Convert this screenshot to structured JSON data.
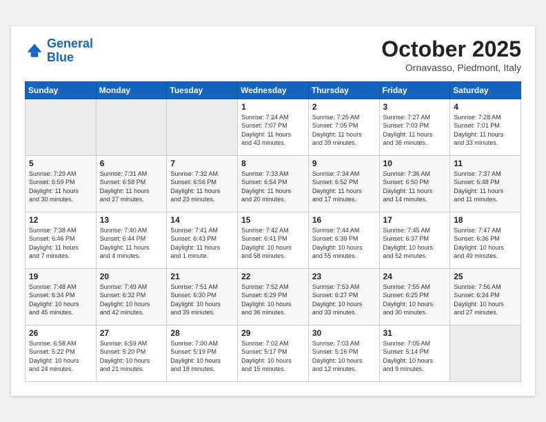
{
  "header": {
    "logo": {
      "line1": "General",
      "line2": "Blue"
    },
    "title": "October 2025",
    "location": "Ornavasso, Piedmont, Italy"
  },
  "weekdays": [
    "Sunday",
    "Monday",
    "Tuesday",
    "Wednesday",
    "Thursday",
    "Friday",
    "Saturday"
  ],
  "weeks": [
    [
      {
        "day": "",
        "info": ""
      },
      {
        "day": "",
        "info": ""
      },
      {
        "day": "",
        "info": ""
      },
      {
        "day": "1",
        "info": "Sunrise: 7:24 AM\nSunset: 7:07 PM\nDaylight: 11 hours\nand 43 minutes."
      },
      {
        "day": "2",
        "info": "Sunrise: 7:25 AM\nSunset: 7:05 PM\nDaylight: 11 hours\nand 39 minutes."
      },
      {
        "day": "3",
        "info": "Sunrise: 7:27 AM\nSunset: 7:03 PM\nDaylight: 11 hours\nand 36 minutes."
      },
      {
        "day": "4",
        "info": "Sunrise: 7:28 AM\nSunset: 7:01 PM\nDaylight: 11 hours\nand 33 minutes."
      }
    ],
    [
      {
        "day": "5",
        "info": "Sunrise: 7:29 AM\nSunset: 6:59 PM\nDaylight: 11 hours\nand 30 minutes."
      },
      {
        "day": "6",
        "info": "Sunrise: 7:31 AM\nSunset: 6:58 PM\nDaylight: 11 hours\nand 27 minutes."
      },
      {
        "day": "7",
        "info": "Sunrise: 7:32 AM\nSunset: 6:56 PM\nDaylight: 11 hours\nand 23 minutes."
      },
      {
        "day": "8",
        "info": "Sunrise: 7:33 AM\nSunset: 6:54 PM\nDaylight: 11 hours\nand 20 minutes."
      },
      {
        "day": "9",
        "info": "Sunrise: 7:34 AM\nSunset: 6:52 PM\nDaylight: 11 hours\nand 17 minutes."
      },
      {
        "day": "10",
        "info": "Sunrise: 7:36 AM\nSunset: 6:50 PM\nDaylight: 11 hours\nand 14 minutes."
      },
      {
        "day": "11",
        "info": "Sunrise: 7:37 AM\nSunset: 6:48 PM\nDaylight: 11 hours\nand 11 minutes."
      }
    ],
    [
      {
        "day": "12",
        "info": "Sunrise: 7:38 AM\nSunset: 6:46 PM\nDaylight: 11 hours\nand 7 minutes."
      },
      {
        "day": "13",
        "info": "Sunrise: 7:40 AM\nSunset: 6:44 PM\nDaylight: 11 hours\nand 4 minutes."
      },
      {
        "day": "14",
        "info": "Sunrise: 7:41 AM\nSunset: 6:43 PM\nDaylight: 11 hours\nand 1 minute."
      },
      {
        "day": "15",
        "info": "Sunrise: 7:42 AM\nSunset: 6:41 PM\nDaylight: 10 hours\nand 58 minutes."
      },
      {
        "day": "16",
        "info": "Sunrise: 7:44 AM\nSunset: 6:39 PM\nDaylight: 10 hours\nand 55 minutes."
      },
      {
        "day": "17",
        "info": "Sunrise: 7:45 AM\nSunset: 6:37 PM\nDaylight: 10 hours\nand 52 minutes."
      },
      {
        "day": "18",
        "info": "Sunrise: 7:47 AM\nSunset: 6:36 PM\nDaylight: 10 hours\nand 49 minutes."
      }
    ],
    [
      {
        "day": "19",
        "info": "Sunrise: 7:48 AM\nSunset: 6:34 PM\nDaylight: 10 hours\nand 45 minutes."
      },
      {
        "day": "20",
        "info": "Sunrise: 7:49 AM\nSunset: 6:32 PM\nDaylight: 10 hours\nand 42 minutes."
      },
      {
        "day": "21",
        "info": "Sunrise: 7:51 AM\nSunset: 6:30 PM\nDaylight: 10 hours\nand 39 minutes."
      },
      {
        "day": "22",
        "info": "Sunrise: 7:52 AM\nSunset: 6:29 PM\nDaylight: 10 hours\nand 36 minutes."
      },
      {
        "day": "23",
        "info": "Sunrise: 7:53 AM\nSunset: 6:27 PM\nDaylight: 10 hours\nand 33 minutes."
      },
      {
        "day": "24",
        "info": "Sunrise: 7:55 AM\nSunset: 6:25 PM\nDaylight: 10 hours\nand 30 minutes."
      },
      {
        "day": "25",
        "info": "Sunrise: 7:56 AM\nSunset: 6:24 PM\nDaylight: 10 hours\nand 27 minutes."
      }
    ],
    [
      {
        "day": "26",
        "info": "Sunrise: 6:58 AM\nSunset: 5:22 PM\nDaylight: 10 hours\nand 24 minutes."
      },
      {
        "day": "27",
        "info": "Sunrise: 6:59 AM\nSunset: 5:20 PM\nDaylight: 10 hours\nand 21 minutes."
      },
      {
        "day": "28",
        "info": "Sunrise: 7:00 AM\nSunset: 5:19 PM\nDaylight: 10 hours\nand 18 minutes."
      },
      {
        "day": "29",
        "info": "Sunrise: 7:02 AM\nSunset: 5:17 PM\nDaylight: 10 hours\nand 15 minutes."
      },
      {
        "day": "30",
        "info": "Sunrise: 7:03 AM\nSunset: 5:16 PM\nDaylight: 10 hours\nand 12 minutes."
      },
      {
        "day": "31",
        "info": "Sunrise: 7:05 AM\nSunset: 5:14 PM\nDaylight: 10 hours\nand 9 minutes."
      },
      {
        "day": "",
        "info": ""
      }
    ]
  ]
}
